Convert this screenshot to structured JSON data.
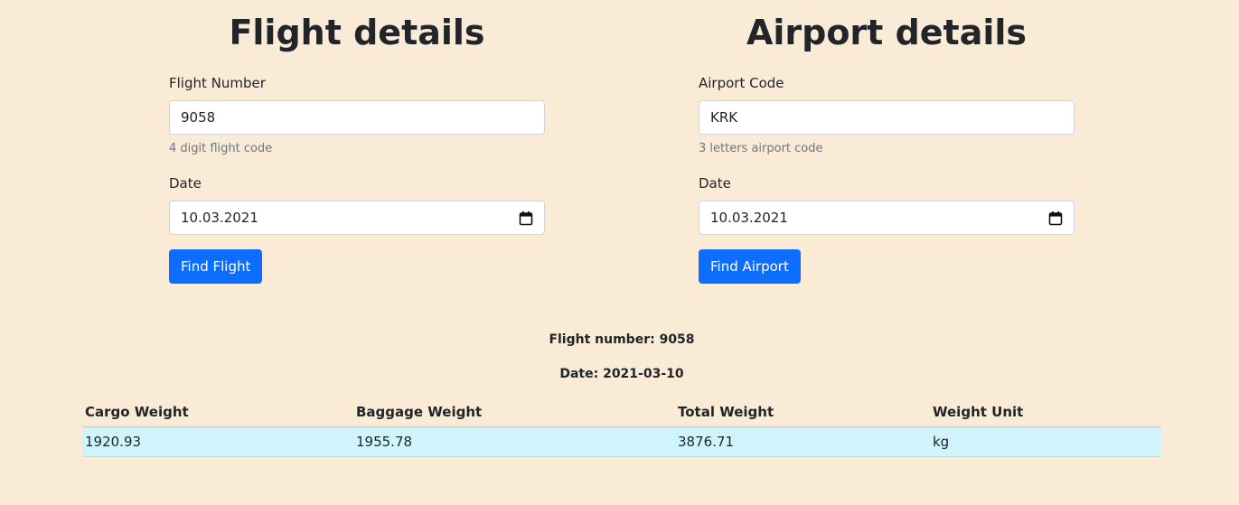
{
  "flight_form": {
    "title": "Flight details",
    "number_label": "Flight Number",
    "number_value": "9058",
    "number_help": "4 digit flight code",
    "date_label": "Date",
    "date_value": "10.03.2021",
    "button_label": "Find Flight"
  },
  "airport_form": {
    "title": "Airport details",
    "code_label": "Airport Code",
    "code_value": "KRK",
    "code_help": "3 letters airport code",
    "date_label": "Date",
    "date_value": "10.03.2021",
    "button_label": "Find Airport"
  },
  "result": {
    "flight_number_label": "Flight number:",
    "flight_number_value": "9058",
    "date_label": "Date:",
    "date_value": "2021-03-10",
    "headers": [
      "Cargo Weight",
      "Baggage Weight",
      "Total Weight",
      "Weight Unit"
    ],
    "rows": [
      [
        "1920.93",
        "1955.78",
        "3876.71",
        "kg"
      ]
    ]
  },
  "colors": {
    "background": "#faebd7",
    "primary": "#0d6efd",
    "row_highlight": "#cff4fc"
  },
  "icons": {
    "date_picker": "calendar-icon"
  }
}
